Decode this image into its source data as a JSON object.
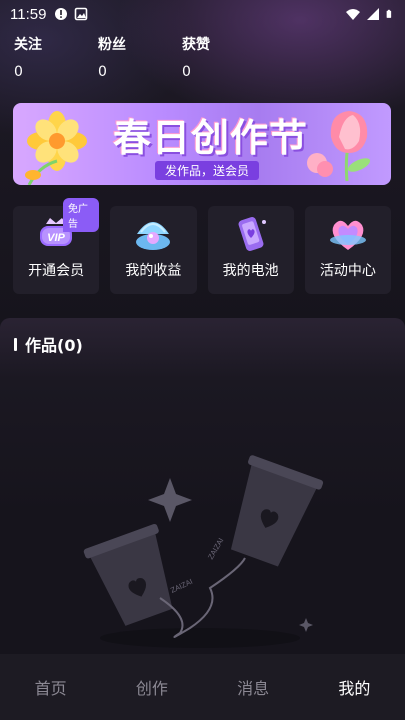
{
  "status_bar": {
    "time": "11:59"
  },
  "stats": [
    {
      "label": "关注",
      "value": "0"
    },
    {
      "label": "粉丝",
      "value": "0"
    },
    {
      "label": "获赞",
      "value": "0"
    }
  ],
  "banner": {
    "title": "春日创作节",
    "subtitle": "发作品，送会员"
  },
  "quick_actions": [
    {
      "label": "开通会员",
      "icon": "vip-crown-icon",
      "badge": "免广告"
    },
    {
      "label": "我的收益",
      "icon": "shell-pearl-icon"
    },
    {
      "label": "我的电池",
      "icon": "battery-phone-icon"
    },
    {
      "label": "活动中心",
      "icon": "heart-gift-icon"
    }
  ],
  "works": {
    "title": "作品(0)"
  },
  "bottom_nav": [
    {
      "label": "首页"
    },
    {
      "label": "创作"
    },
    {
      "label": "消息"
    },
    {
      "label": "我的",
      "active": true
    }
  ],
  "colors": {
    "accent": "#8b5cf6",
    "background": "#16141c",
    "card": "#221f2a"
  }
}
